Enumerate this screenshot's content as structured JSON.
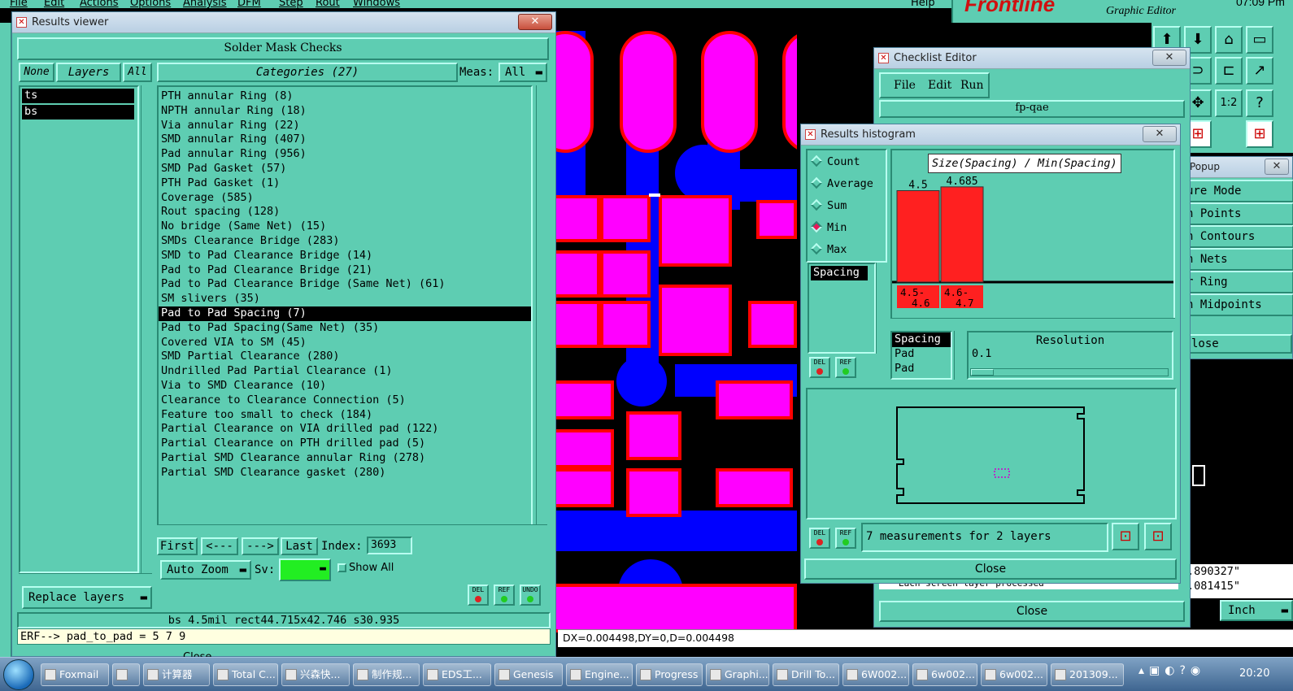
{
  "top_menu": {
    "items": [
      "File",
      "Edit",
      "Actions",
      "Options",
      "Analysis",
      "DFM",
      "Step",
      "Rout",
      "Windows"
    ],
    "help": "Help",
    "brand": "Frontline",
    "graphic_editor": "Graphic Editor",
    "clock_top": "07:09 Pm"
  },
  "results_viewer": {
    "title": "Results viewer",
    "header": "Solder Mask Checks",
    "none_btn": "None",
    "layers_label": "Layers",
    "all_btn": "All",
    "categories_label": "Categories (27)",
    "meas_label": "Meas:",
    "meas_value": "All",
    "layers": [
      {
        "name": "ts",
        "selected": true
      },
      {
        "name": "bs",
        "selected": true
      }
    ],
    "categories": [
      "PTH annular Ring (8)",
      "NPTH annular Ring (18)",
      "Via annular Ring (22)",
      "SMD annular Ring (407)",
      "Pad annular Ring (956)",
      "SMD Pad Gasket (57)",
      "PTH Pad Gasket (1)",
      "Coverage (585)",
      "Rout spacing (128)",
      "No bridge (Same Net) (15)",
      "SMDs Clearance Bridge (283)",
      "SMD to Pad Clearance Bridge (14)",
      "Pad to Pad Clearance Bridge (21)",
      "Pad to Pad Clearance Bridge (Same Net) (61)",
      "SM slivers (35)",
      "Pad to Pad Spacing (7)",
      "Pad to Pad Spacing(Same Net) (35)",
      "Covered VIA to SM (45)",
      "SMD Partial Clearance (280)",
      "Undrilled Pad Partial Clearance (1)",
      "Via to SMD Clearance (10)",
      "Clearance to Clearance Connection (5)",
      "Feature too small to check (184)",
      "Partial Clearance on VIA drilled pad (122)",
      "Partial Clearance on PTH drilled pad (5)",
      "Partial SMD Clearance annular Ring (278)",
      "Partial SMD Clearance gasket (280)"
    ],
    "selected_category_index": 15,
    "first_btn": "First",
    "prev_btn": "<---",
    "next_btn": "--->",
    "last_btn": "Last",
    "index_label": "Index:",
    "index_value": "3693",
    "auto_zoom": "Auto Zoom",
    "sv_label": "Sv:",
    "sv_color": "#22ee22",
    "show_all": "Show All",
    "replace_layers": "Replace layers",
    "del": "DEL",
    "ref": "REF",
    "undo": "UNDO",
    "status_line": "bs 4.5mil  rect44.715x42.746  s30.935",
    "erf_line": "ERF--> pad_to_pad = 5 7 9",
    "close_partial": "Close"
  },
  "checklist_editor": {
    "title": "Checklist Editor",
    "menu": [
      "File",
      "Edit",
      "Run"
    ],
    "name": "fp-qae",
    "close_btn": "Close",
    "status_text": "Each screen layer processed"
  },
  "popup": {
    "title": "Popup",
    "items": [
      "ure Mode",
      "n Points",
      "n Contours",
      "n Nets",
      "r Ring",
      "n Midpoints"
    ],
    "close": "lose",
    "coord1": ".890327\"",
    "coord2": ".081415\"",
    "unit": "Inch"
  },
  "histogram": {
    "title": "Results histogram",
    "modes": [
      "Count",
      "Average",
      "Sum",
      "Min",
      "Max"
    ],
    "selected_mode": "Min",
    "chart_title": "Size(Spacing) / Min(Spacing)",
    "chart_data": {
      "type": "bar",
      "categories": [
        "4.5-4.6",
        "4.6-4.7"
      ],
      "values": [
        4.5,
        4.685
      ],
      "title": "Size(Spacing) / Min(Spacing)",
      "ylim": [
        0,
        5.2
      ],
      "color": "#ff2020"
    },
    "left_list": [
      "Spacing"
    ],
    "sub_list": [
      "Spacing",
      "Pad",
      "Pad"
    ],
    "resolution_label": "Resolution",
    "resolution_value": "0.1",
    "measurements": "7 measurements for 2 layers",
    "close_btn": "Close"
  },
  "bottom_bar": {
    "dxdy": "DX=0.004498,DY=0,D=0.004498"
  },
  "taskbar": {
    "items": [
      "Foxmail",
      "",
      "计算器",
      "Total C...",
      "兴森快...",
      "制作规...",
      "EDS工...",
      "Genesis",
      "Engine...",
      "Progress",
      "Graphi...",
      "Drill To...",
      "6W002...",
      "6w002...",
      "6w002...",
      "201309..."
    ],
    "clock": "20:20"
  }
}
